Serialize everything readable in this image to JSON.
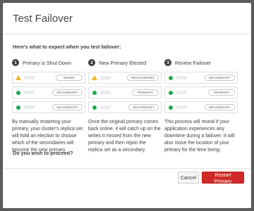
{
  "dialog": {
    "title": "Test Failover",
    "intro": "Here's what to expect when you test failover:",
    "question": "Do you wish to proceed?",
    "cancel_label": "Cancel",
    "confirm_label": "Restart Primary"
  },
  "colors": {
    "ok": "#1fa84a",
    "warning": "#f2b526",
    "primary_button": "#d02a28"
  },
  "steps": [
    {
      "number": "1",
      "title": "Primary is Shut Down",
      "nodes": [
        {
          "status": "warning-icon",
          "label": "DOWN"
        },
        {
          "status": "ok",
          "label": "SECONDARY"
        },
        {
          "status": "ok",
          "label": "SECONDARY"
        }
      ],
      "description": "By manually restarting your primary, your cluster's replica set will hold an election to choose which of the secondaries will become the new primary."
    },
    {
      "number": "2",
      "title": "New Primary Elected",
      "nodes": [
        {
          "status": "warning-icon",
          "label": "RECOVERING"
        },
        {
          "status": "ok",
          "label": "PRIMARY"
        },
        {
          "status": "ok",
          "label": "SECONDARY"
        }
      ],
      "description": "Once the original primary comes back online, it will catch up on the writes it missed from the new primary and then rejoin the replica set as a secondary."
    },
    {
      "number": "3",
      "title": "Review Failover",
      "nodes": [
        {
          "status": "ok",
          "label": "SECONDARY"
        },
        {
          "status": "ok",
          "label": "PRIMARY"
        },
        {
          "status": "ok",
          "label": "SECONDARY"
        }
      ],
      "description": "This process will reveal if your application experiences any downtime during a failover. It will also move the location of your primary for the time being."
    }
  ]
}
